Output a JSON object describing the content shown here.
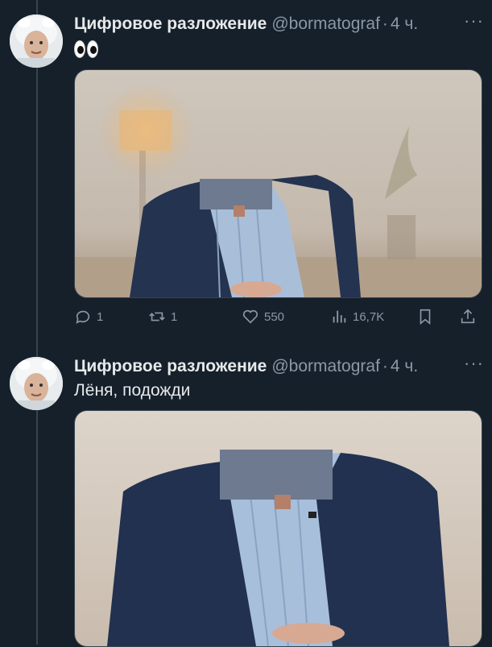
{
  "tweets": [
    {
      "author_name": "Цифровое разложение",
      "handle": "@bormatograf",
      "separator": "·",
      "time": "4 ч.",
      "more": "···",
      "text": "",
      "emoji": "eyes",
      "actions": {
        "replies": "1",
        "retweets": "1",
        "likes": "550",
        "views": "16,7K"
      }
    },
    {
      "author_name": "Цифровое разложение",
      "handle": "@bormatograf",
      "separator": "·",
      "time": "4 ч.",
      "more": "···",
      "text": "Лёня, подожди"
    }
  ],
  "icons": {
    "reply": "reply-icon",
    "retweet": "retweet-icon",
    "like": "heart-icon",
    "views": "views-icon",
    "bookmark": "bookmark-icon",
    "share": "share-icon"
  },
  "colors": {
    "background": "#15202b",
    "text": "#e7e9ea",
    "muted": "#8b98a5",
    "border": "#38444d"
  }
}
